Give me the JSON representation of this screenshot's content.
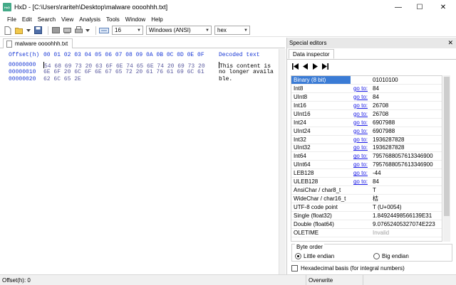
{
  "window": {
    "app_icon_text": "HxD",
    "title": "HxD - [C:\\Users\\rariteh\\Desktop\\malware oooohhh.txt]",
    "minimize": "—",
    "maximize": "☐",
    "close": "✕"
  },
  "menu": [
    "File",
    "Edit",
    "Search",
    "View",
    "Analysis",
    "Tools",
    "Window",
    "Help"
  ],
  "toolbar": {
    "bytes_per_row": "16",
    "charset": "Windows (ANSI)",
    "display_mode": "hex"
  },
  "document_tab": {
    "label": "malware oooohhh.txt"
  },
  "hex_editor": {
    "header_offset": "Offset(h)",
    "header_columns": "00 01 02 03 04 05 06 07 08 09 0A 0B 0C 0D 0E 0F",
    "header_decoded": "Decoded text",
    "rows": [
      {
        "offset": "00000000",
        "bytes": "54 68 69 73 20 63 6F 6E 74 65 6E 74 20 69 73 20",
        "text": "This content is "
      },
      {
        "offset": "00000010",
        "bytes": "6E 6F 20 6C 6F 6E 67 65 72 20 61 76 61 69 6C 61",
        "text": "no longer availa"
      },
      {
        "offset": "00000020",
        "bytes": "62 6C 65 2E",
        "text": "ble."
      }
    ]
  },
  "special_editors": {
    "title": "Special editors",
    "close": "✕",
    "tab": "Data inspector",
    "goto_label": "go to:",
    "rows": [
      {
        "name": "Binary (8 bit)",
        "goto": false,
        "value": "01010100",
        "selected": true
      },
      {
        "name": "Int8",
        "goto": true,
        "value": "84"
      },
      {
        "name": "UInt8",
        "goto": true,
        "value": "84"
      },
      {
        "name": "Int16",
        "goto": true,
        "value": "26708"
      },
      {
        "name": "UInt16",
        "goto": true,
        "value": "26708"
      },
      {
        "name": "Int24",
        "goto": true,
        "value": "6907988"
      },
      {
        "name": "UInt24",
        "goto": true,
        "value": "6907988"
      },
      {
        "name": "Int32",
        "goto": true,
        "value": "1936287828"
      },
      {
        "name": "UInt32",
        "goto": true,
        "value": "1936287828"
      },
      {
        "name": "Int64",
        "goto": true,
        "value": "7957688057613346900"
      },
      {
        "name": "UInt64",
        "goto": true,
        "value": "7957688057613346900"
      },
      {
        "name": "LEB128",
        "goto": true,
        "value": "-44"
      },
      {
        "name": "ULEB128",
        "goto": true,
        "value": "84"
      },
      {
        "name": "AnsiChar / char8_t",
        "goto": false,
        "value": "T"
      },
      {
        "name": "WideChar / char16_t",
        "goto": false,
        "value": "桔"
      },
      {
        "name": "UTF-8 code point",
        "goto": false,
        "value": "T (U+0054)"
      },
      {
        "name": "Single (float32)",
        "goto": false,
        "value": "1.84924498566139E31"
      },
      {
        "name": "Double (float64)",
        "goto": false,
        "value": "9.07652405327074E223"
      },
      {
        "name": "OLETIME",
        "goto": false,
        "value": "Invalid",
        "muted": true
      }
    ],
    "byte_order": {
      "label": "Byte order",
      "little": "Little endian",
      "big": "Big endian",
      "selected": "little"
    },
    "hex_basis": "Hexadecimal basis (for integral numbers)"
  },
  "statusbar": {
    "offset": "Offset(h): 0",
    "mode": "Overwrite"
  },
  "colors": {
    "header_blue": "#1c3bd6",
    "selection": "#3a7bd5",
    "link": "#1a1ae6"
  }
}
